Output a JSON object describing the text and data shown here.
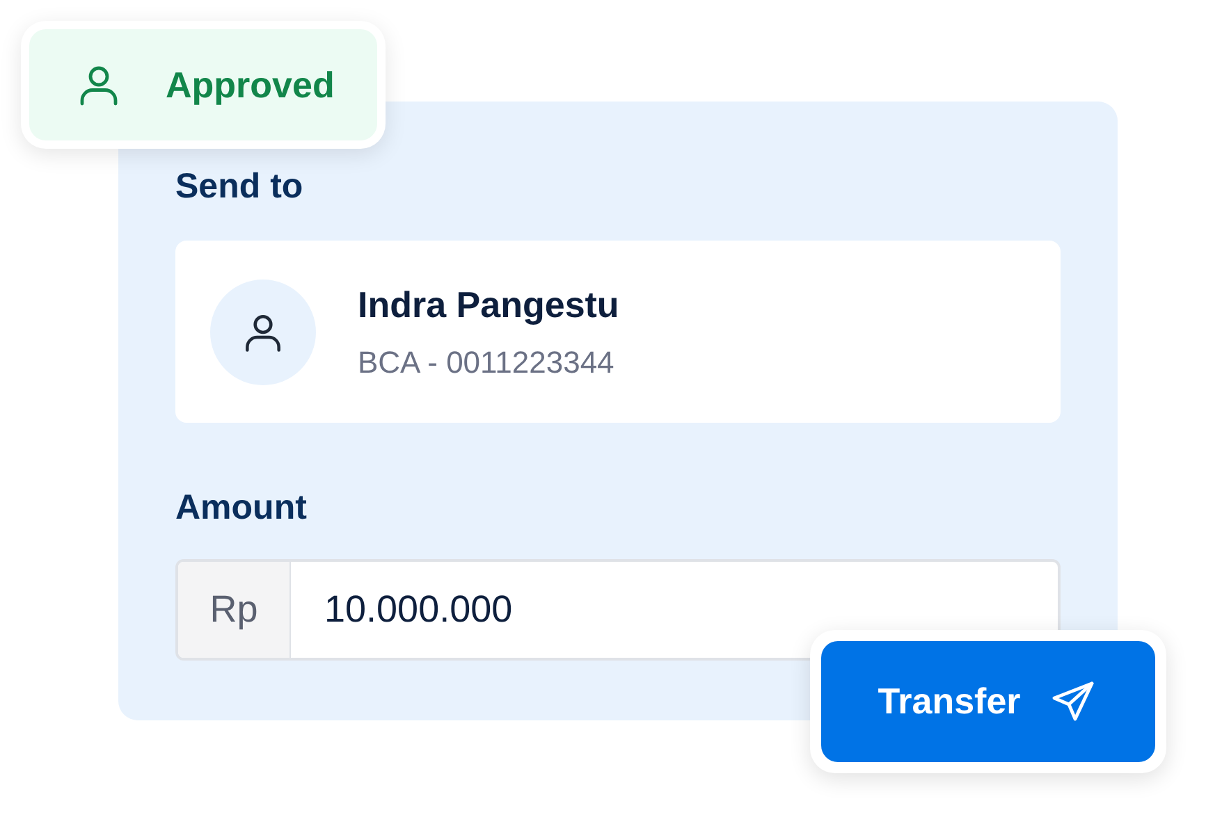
{
  "status_badge": {
    "label": "Approved"
  },
  "send_to": {
    "label": "Send to",
    "recipient": {
      "name": "Indra Pangestu",
      "account": "BCA - 0011223344"
    }
  },
  "amount": {
    "label": "Amount",
    "prefix": "Rp",
    "value": "10.000.000"
  },
  "transfer_button": {
    "label": "Transfer"
  }
}
